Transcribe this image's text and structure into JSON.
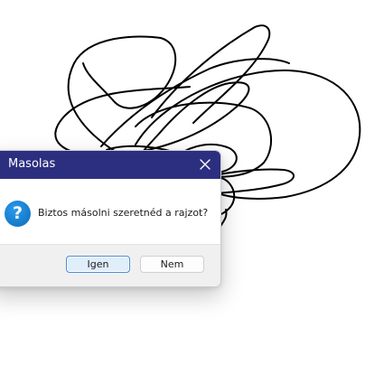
{
  "dialog": {
    "title": "Masolas",
    "close_icon": "close-icon",
    "message": "Biztos másolni szeretnéd a rajzot?",
    "icon": "question-icon",
    "icon_glyph": "?",
    "buttons": {
      "yes_label": "Igen",
      "no_label": "Nem"
    }
  },
  "colors": {
    "titlebar": "#2c2f80",
    "icon": "#1a86d9",
    "default_button_border": "#4c8fd4",
    "scribble": "#000000"
  }
}
